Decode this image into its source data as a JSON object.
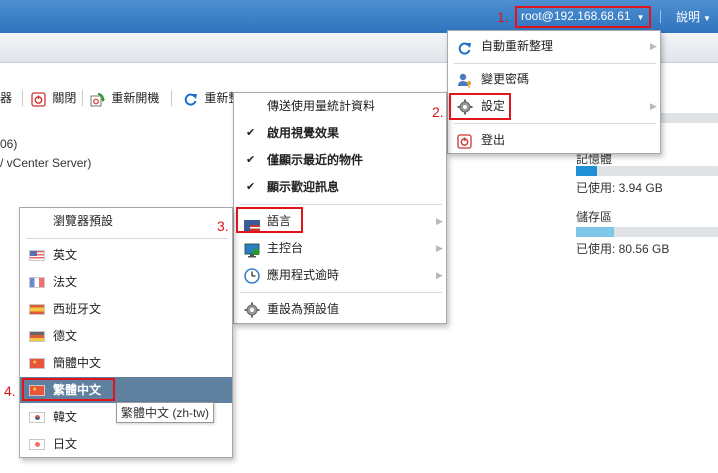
{
  "topbar": {
    "user_label": "root@192.168.68.61",
    "help_label": "說明"
  },
  "toolbar": {
    "partial_left": "器",
    "shutdown_label": "關閉",
    "restart_label": "重新開機",
    "refresh_partial": "重新整"
  },
  "host_info": {
    "line1": "06)",
    "line2": "/ vCenter Server)"
  },
  "resources": {
    "memory_title": "記憶體",
    "memory_used": "已使用: 3.94 GB",
    "memory_fraction": 0.15,
    "storage_title": "儲存區",
    "storage_used": "已使用: 80.56 GB",
    "storage_fraction": 0.27
  },
  "user_menu": {
    "items": [
      {
        "label": "自動重新整理",
        "has_submenu": true
      },
      {
        "label": "變更密碼",
        "has_submenu": false
      },
      {
        "label": "設定",
        "has_submenu": true
      },
      {
        "label": "登出",
        "has_submenu": false
      }
    ]
  },
  "settings_menu": {
    "items": [
      {
        "label": "傳送使用量統計資料",
        "checked": false,
        "has_submenu": false
      },
      {
        "label": "啟用視覺效果",
        "checked": true,
        "has_submenu": false
      },
      {
        "label": "僅顯示最近的物件",
        "checked": true,
        "has_submenu": false
      },
      {
        "label": "顯示歡迎訊息",
        "checked": true,
        "has_submenu": false
      },
      {
        "label": "語言",
        "checked": false,
        "has_submenu": true
      },
      {
        "label": "主控台",
        "checked": false,
        "has_submenu": true
      },
      {
        "label": "應用程式逾時",
        "checked": false,
        "has_submenu": true
      },
      {
        "label": "重設為預設值",
        "checked": false,
        "has_submenu": false
      }
    ]
  },
  "language_menu": {
    "browser_default": "瀏覽器預設",
    "languages": [
      {
        "label": "英文",
        "flag": "us"
      },
      {
        "label": "法文",
        "flag": "fr"
      },
      {
        "label": "西班牙文",
        "flag": "es"
      },
      {
        "label": "德文",
        "flag": "de"
      },
      {
        "label": "簡體中文",
        "flag": "cn"
      },
      {
        "label": "繁體中文",
        "flag": "tw",
        "selected": true
      },
      {
        "label": "韓文",
        "flag": "kr"
      },
      {
        "label": "日文",
        "flag": "jp"
      }
    ],
    "tooltip": "繁體中文 (zh-tw)"
  },
  "steps": {
    "s1": "1.",
    "s2": "2.",
    "s3": "3.",
    "s4": "4."
  },
  "colors": {
    "topbar": "#3a7cc4",
    "highlight": "#e0141a",
    "selected_row": "#6080a0",
    "memory_fill": "#1f8fd6",
    "storage_fill": "#7ec6e6"
  },
  "icons": {
    "refresh": "refresh-icon",
    "change_password": "user-key-icon",
    "settings": "gear-icon",
    "logout": "logout-icon"
  }
}
